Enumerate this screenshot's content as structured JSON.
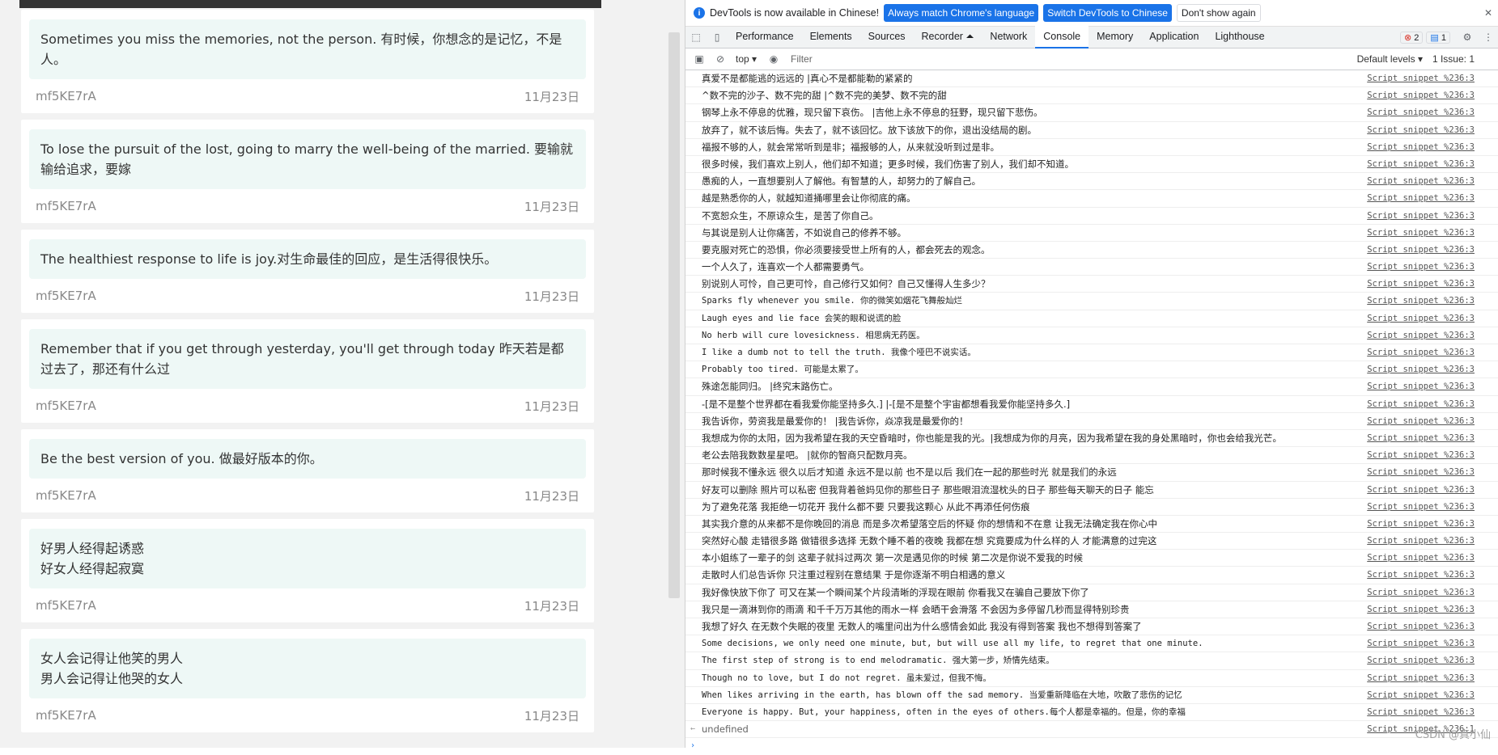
{
  "cards": [
    {
      "quote": "Sometimes you miss the memories, not the person. 有时候，你想念的是记忆，不是人。",
      "author": "mf5KE7rA",
      "date": "11月23日"
    },
    {
      "quote": "To lose the pursuit of the lost, going to marry the well-being of the married. 要输就输给追求，要嫁",
      "author": "mf5KE7rA",
      "date": "11月23日"
    },
    {
      "quote": "The healthiest response to life is joy.对生命最佳的回应，是生活得很快乐。",
      "author": "mf5KE7rA",
      "date": "11月23日"
    },
    {
      "quote": "Remember that if you get through yesterday, you'll get through today 昨天若是都过去了，那还有什么过",
      "author": "mf5KE7rA",
      "date": "11月23日"
    },
    {
      "quote": "Be the best version of you. 做最好版本的你。",
      "author": "mf5KE7rA",
      "date": "11月23日"
    },
    {
      "quote": "好男人经得起诱惑\n好女人经得起寂寞",
      "author": "mf5KE7rA",
      "date": "11月23日"
    },
    {
      "quote": "女人会记得让他笑的男人\n男人会记得让他哭的女人",
      "author": "mf5KE7rA",
      "date": "11月23日"
    }
  ],
  "devtools": {
    "infobar": {
      "message": "DevTools is now available in Chinese!",
      "btn_match": "Always match Chrome's language",
      "btn_switch": "Switch DevTools to Chinese",
      "btn_dismiss": "Don't show again"
    },
    "tabs": [
      "Performance",
      "Elements",
      "Sources",
      "Recorder ⏶",
      "Network",
      "Console",
      "Memory",
      "Application",
      "Lighthouse"
    ],
    "active_tab": "Console",
    "error_count": "2",
    "message_count": "1",
    "toolbar": {
      "context": "top",
      "filter_placeholder": "Filter",
      "levels": "Default levels",
      "issues": "1 Issue: 1"
    },
    "log_source": "Script snippet %236:3",
    "log": [
      "真爱不是都能逃的远远的 |真心不是都能勒的紧紧的",
      "^数不完的沙子、数不完的甜 |^数不完的美梦、数不完的甜",
      "钢琴上永不停息的优雅，现只留下哀伤。 |吉他上永不停息的狂野，现只留下悲伤。",
      "放弃了，就不该后悔。失去了，就不该回忆。放下该放下的你，退出没结局的剧。",
      "福报不够的人，就会常常听到是非；福报够的人，从来就没听到过是非。",
      "很多时候，我们喜欢上别人，他们却不知道；更多时候，我们伤害了别人，我们却不知道。",
      "愚痴的人，一直想要别人了解他。有智慧的人，却努力的了解自己。",
      "越是熟悉你的人，就越知道捅哪里会让你彻底的痛。",
      "不宽恕众生，不原谅众生，是苦了你自己。",
      "与其说是别人让你痛苦，不如说自己的修养不够。",
      "要克服对死亡的恐惧，你必须要接受世上所有的人，都会死去的观念。",
      "一个人久了，连喜欢一个人都需要勇气。",
      "别说别人可怜，自己更可怜，自己修行又如何？自己又懂得人生多少？",
      "Sparks fly whenever you smile.  你的微笑如烟花飞舞般灿烂",
      " Laugh eyes and lie face   会笑的眼和说谎的脸",
      " No herb will cure lovesickness.  相思病无药医。",
      " I like a dumb not to tell the truth.  我像个哑巴不说实话。",
      " Probably too tired.  可能是太累了。",
      "殊途怎能同归。 |终究末路伤亡。",
      "-[是不是整个世界都在看我爱你能坚持多久.] |-[是不是整个宇宙都想看我爱你能坚持多久.]",
      "我告诉你，劳资我是最爱你的！ |我告诉你，焱凉我是最爱你的！",
      "我想成为你的太阳，因为我希望在我的天空昏暗时，你也能是我的光。|我想成为你的月亮，因为我希望在我的身处黑暗时，你也会给我光芒。",
      "老公去陪我数数星星吧。 |就你的智商只配数月亮。",
      "那时候我不懂永远 很久以后才知道 永远不是以前 也不是以后 我们在一起的那些时光 就是我们的永远",
      "好友可以删除 照片可以私密 但我背着爸妈见你的那些日子 那些眼泪流湿枕头的日子 那些每天聊天的日子 能忘",
      "为了避免花落 我拒绝一切花开 我什么都不要 只要我这颗心 从此不再添任何伤痕",
      "其实我介意的从来都不是你晚回的消息 而是多次希望落空后的怀疑 你的想情和不在意 让我无法确定我在你心中",
      "突然好心酸 走错很多路 做错很多选择 无数个睡不着的夜晚 我都在想 究竟要成为什么样的人 才能满意的过完这",
      "本小姐练了一辈子的剑 这辈子就抖过两次 第一次是遇见你的时候 第二次是你说不爱我的时候",
      "走散时人们总告诉你 只注重过程别在意结果 于是你逐渐不明白相遇的意义",
      "我好像快放下你了 可又在某一个瞬间某个片段清晰的浮现在眼前 你看我又在骗自己要放下你了",
      "我只是一滴淋到你的雨滴 和千千万万其他的雨水一样 会晒干会滑落 不会因为多停留几秒而显得特别珍贵",
      "我想了好久 在无数个失眠的夜里 无数人的嘴里问出为什么感情会如此 我没有得到答案 我也不想得到答案了",
      "Some decisions, we only need one minute, but, but will use all my life, to regret that one minute.",
      "The first step of strong is to end melodramatic. 强大第一步，矫情先结束。",
      "Though no to love, but I do not regret. 虽未爱过，但我不悔。",
      "When likes arriving in the earth, has blown off the sad memory. 当爱重新降临在大地，吹散了悲伤的记忆",
      "Everyone is happy. But, your happiness, often in the eyes of others.每个人都是幸福的。但是，你的幸福"
    ],
    "result_text": "undefined",
    "result_source": "Script snippet %236:1",
    "watermark": "CSDN @真小仙"
  }
}
